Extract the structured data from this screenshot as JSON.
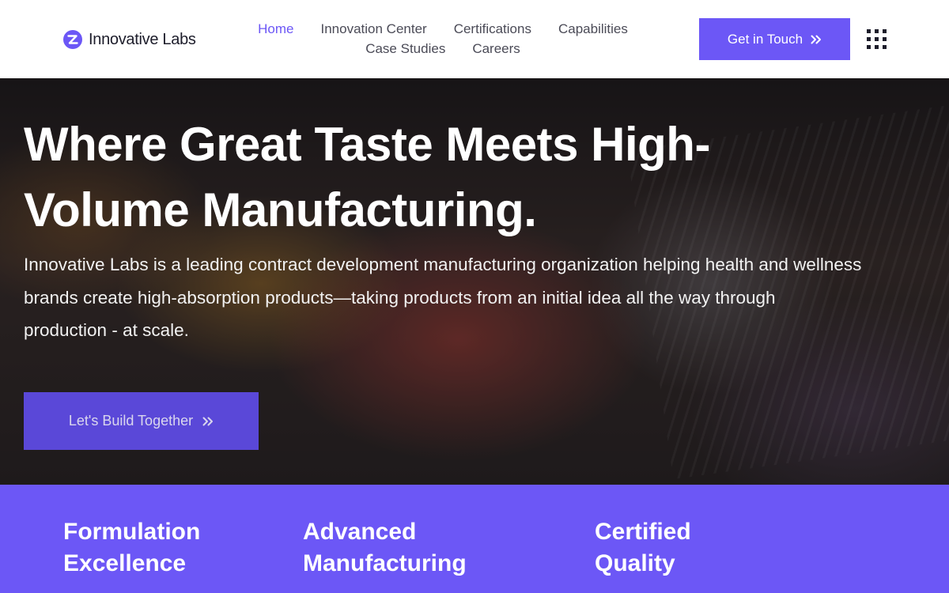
{
  "brand": {
    "name": "Innovative Labs",
    "logo_icon": "stylized-z-logo",
    "accent_color": "#6c57f6"
  },
  "nav": {
    "row1": [
      {
        "label": "Home",
        "active": true
      },
      {
        "label": "Innovation Center",
        "active": false
      },
      {
        "label": "Certifications",
        "active": false
      },
      {
        "label": "Capabilities",
        "active": false
      }
    ],
    "row2": [
      {
        "label": "Case Studies",
        "active": false
      },
      {
        "label": "Careers",
        "active": false
      }
    ]
  },
  "header": {
    "cta_label": "Get in Touch",
    "cta_icon": "double-chevron-right-icon",
    "menu_icon": "grid-menu-icon"
  },
  "hero": {
    "title_line1": "Where Great Taste Meets High-",
    "title_line2": "Volume Manufacturing.",
    "description_line1": "Innovative Labs is a leading contract development manufacturing organization helping health and wellness",
    "description_line2": "brands create high-absorption products—taking products from an initial idea all the way through",
    "description_line3": "production - at scale.",
    "cta_label": "Let's Build Together",
    "cta_icon": "double-chevron-right-icon"
  },
  "features": [
    {
      "line1": "Formulation",
      "line2": "Excellence"
    },
    {
      "line1": "Advanced",
      "line2": "Manufacturing"
    },
    {
      "line1": "Certified",
      "line2": "Quality"
    }
  ]
}
